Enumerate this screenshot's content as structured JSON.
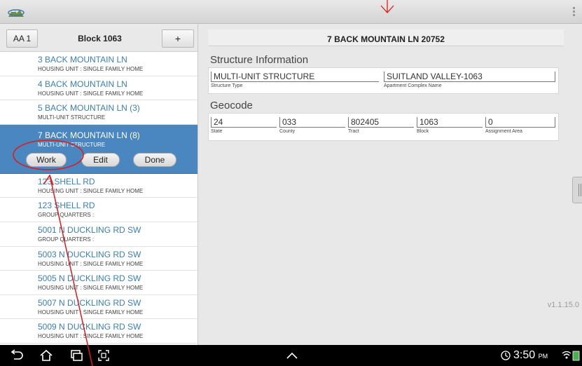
{
  "left_pane": {
    "aa_label": "AA 1",
    "block_label": "Block 1063",
    "add_label": "+",
    "items": [
      {
        "address": "3 BACK MOUNTAIN LN",
        "type": "HOUSING UNIT : SINGLE FAMILY HOME"
      },
      {
        "address": "4 BACK MOUNTAIN LN",
        "type": "HOUSING UNIT : SINGLE FAMILY HOME"
      },
      {
        "address": "5 BACK MOUNTAIN LN (3)",
        "type": "MULTI-UNIT STRUCTURE"
      },
      {
        "address": "7 BACK MOUNTAIN LN (8)",
        "type": "MULTI-UNIT STRUCTURE"
      },
      {
        "address": "123 SHELL RD",
        "type": "HOUSING UNIT : SINGLE FAMILY HOME"
      },
      {
        "address": "123 SHELL RD",
        "type": "GROUP QUARTERS :"
      },
      {
        "address": "5001 N DUCKLING RD SW",
        "type": "GROUP QUARTERS :"
      },
      {
        "address": "5003 N DUCKLING RD SW",
        "type": "HOUSING UNIT : SINGLE FAMILY HOME"
      },
      {
        "address": "5005 N DUCKLING RD SW",
        "type": "HOUSING UNIT : SINGLE FAMILY HOME"
      },
      {
        "address": "5007 N DUCKLING RD SW",
        "type": "HOUSING UNIT : SINGLE FAMILY HOME"
      },
      {
        "address": "5009 N DUCKLING RD SW",
        "type": "HOUSING UNIT : SINGLE FAMILY HOME"
      }
    ],
    "actions": {
      "work": "Work",
      "edit": "Edit",
      "done": "Done"
    }
  },
  "detail": {
    "title": "7 BACK MOUNTAIN LN  20752",
    "structure_heading": "Structure Information",
    "structure_type_value": "MULTI-UNIT STRUCTURE",
    "structure_type_label": "Structure Type",
    "complex_value": "SUITLAND VALLEY-1063",
    "complex_label": "Apartment Complex Name",
    "geocode_heading": "Geocode",
    "state_value": "24",
    "state_label": "State",
    "county_value": "033",
    "county_label": "County",
    "tract_value": "802405",
    "tract_label": "Tract",
    "block_value": "1063",
    "block_label": "Block",
    "aa_value": "0",
    "aa_label": "Assignment Area"
  },
  "version": "v1.1.15.0",
  "status_bar": {
    "time": "3:50",
    "ampm": "PM"
  },
  "colors": {
    "selected": "#4a86c0",
    "link": "#3b7fb5",
    "annotation": "#e01a1a"
  }
}
